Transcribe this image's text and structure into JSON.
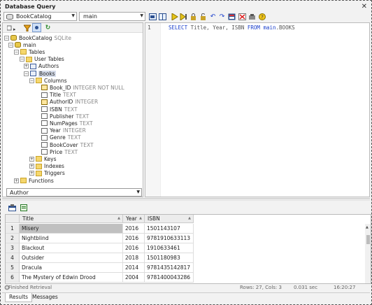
{
  "window": {
    "title": "Database Query",
    "close_glyph": "✕"
  },
  "toolbar": {
    "datasource": "BookCatalog",
    "schema": "main",
    "icons": [
      "sql-editor-icon",
      "split-view-icon",
      "execute-icon",
      "execute-step-icon",
      "lock-icon",
      "unlock-icon",
      "undo-icon",
      "redo-icon",
      "query-grid-icon",
      "clear-icon",
      "settings-icon",
      "help-icon"
    ]
  },
  "tree_toolbar": {
    "icons": [
      "filter-icon",
      "find-icon",
      "refresh-icon"
    ]
  },
  "tree": [
    {
      "label": "BookCatalog",
      "sub": "SQLite",
      "icon": "db",
      "exp": "-"
    },
    {
      "label": "main",
      "icon": "db",
      "exp": "-"
    },
    {
      "label": "Tables",
      "icon": "folder",
      "exp": "-"
    },
    {
      "label": "User Tables",
      "icon": "folder",
      "exp": "-"
    },
    {
      "label": "Authors",
      "icon": "tbl",
      "exp": "+"
    },
    {
      "label": "Books",
      "icon": "tbl",
      "exp": "-",
      "selected": true
    },
    {
      "label": "Columns",
      "icon": "folder",
      "exp": "-"
    },
    {
      "label": "Book_ID",
      "sub": "INTEGER NOT NULL",
      "icon": "pk"
    },
    {
      "label": "Title",
      "sub": "TEXT",
      "icon": "col"
    },
    {
      "label": "AuthorID",
      "sub": "INTEGER",
      "icon": "pk"
    },
    {
      "label": "ISBN",
      "sub": "TEXT",
      "icon": "col"
    },
    {
      "label": "Publisher",
      "sub": "TEXT",
      "icon": "col"
    },
    {
      "label": "NumPages",
      "sub": "TEXT",
      "icon": "col"
    },
    {
      "label": "Year",
      "sub": "INTEGER",
      "icon": "col"
    },
    {
      "label": "Genre",
      "sub": "TEXT",
      "icon": "col"
    },
    {
      "label": "BookCover",
      "sub": "TEXT",
      "icon": "col"
    },
    {
      "label": "Price",
      "sub": "TEXT",
      "icon": "col"
    },
    {
      "label": "Keys",
      "icon": "folder",
      "exp": "+"
    },
    {
      "label": "Indexes",
      "icon": "folder",
      "exp": "+"
    },
    {
      "label": "Triggers",
      "icon": "folder",
      "exp": "+"
    },
    {
      "label": "Functions",
      "icon": "folder",
      "exp": "+"
    }
  ],
  "filter": {
    "value": "Author"
  },
  "editor": {
    "line_number": "1",
    "kw_select": "SELECT",
    "cols": " Title, Year, ISBN ",
    "kw_from": "FROM",
    "schema": " main",
    "table": ".BOOKS"
  },
  "results": {
    "toolbar_icons": [
      "results-grid-icon",
      "export-icon"
    ],
    "columns": [
      "Title",
      "Year",
      "ISBN"
    ],
    "rows": [
      {
        "n": "1",
        "title": "Misery",
        "year": "2016",
        "isbn": "1501143107"
      },
      {
        "n": "2",
        "title": "Nightblind",
        "year": "2016",
        "isbn": "9781910633113"
      },
      {
        "n": "3",
        "title": "Blackout",
        "year": "2016",
        "isbn": "1910633461"
      },
      {
        "n": "4",
        "title": "Outsider",
        "year": "2018",
        "isbn": "1501180983"
      },
      {
        "n": "5",
        "title": "Dracula",
        "year": "2014",
        "isbn": "9781435142817"
      },
      {
        "n": "6",
        "title": "The Mystery of Edwin Drood",
        "year": "2004",
        "isbn": "9781400043286"
      }
    ],
    "status": {
      "message": "Finished Retrieval",
      "rows_cols": "Rows: 27, Cols: 3",
      "duration": "0.031 sec",
      "time": "16:20:27"
    },
    "tabs": [
      "Results",
      "Messages"
    ]
  }
}
